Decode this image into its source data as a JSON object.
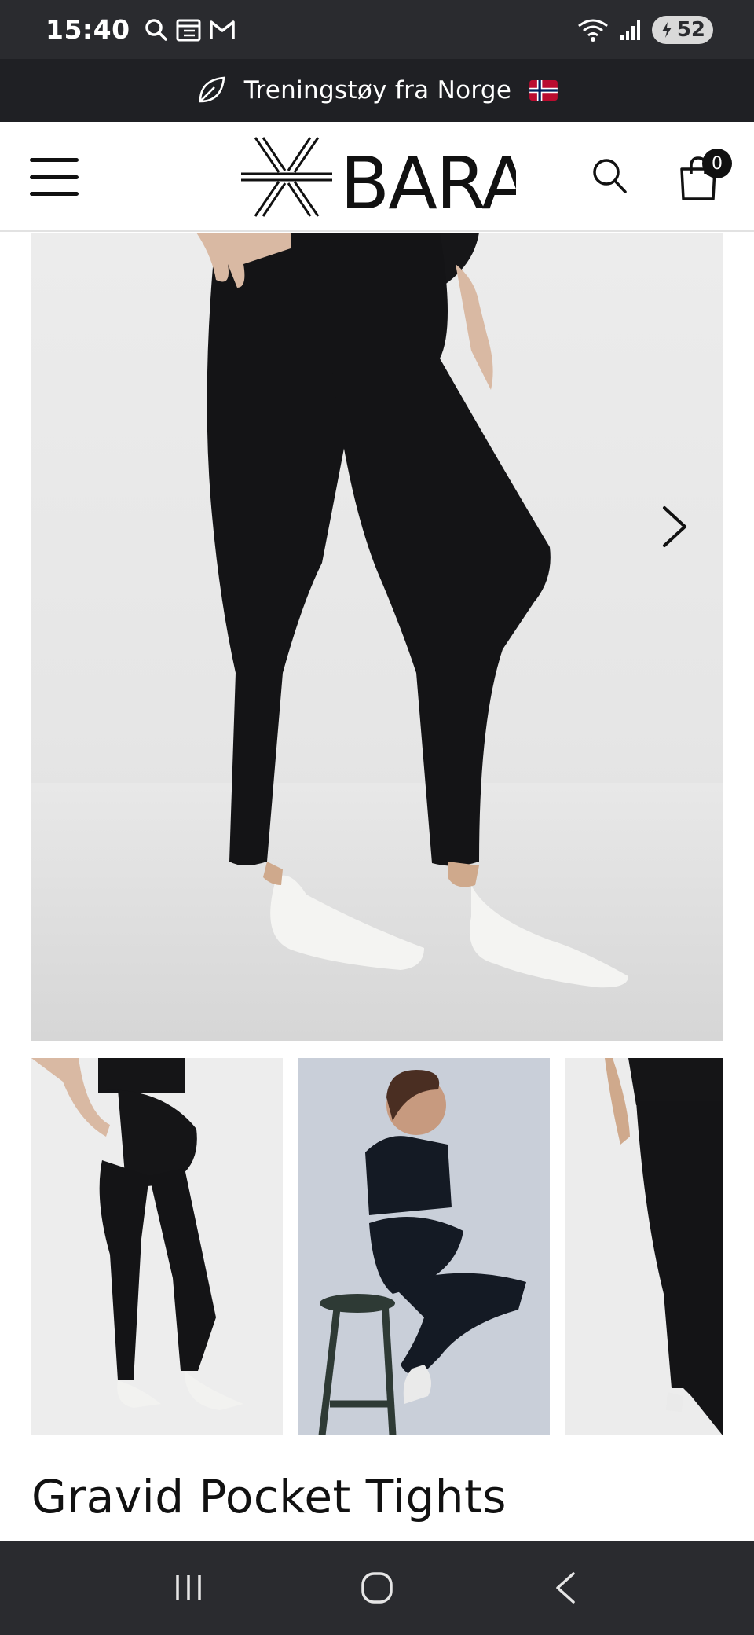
{
  "status_bar": {
    "time": "15:40",
    "battery": "52",
    "icons": [
      "search-icon",
      "calendar-icon",
      "gmail-icon",
      "wifi-icon",
      "signal-icon",
      "battery-icon"
    ]
  },
  "announcement": {
    "text": "Treningstøy fra Norge",
    "icon": "leaf-icon",
    "flag": "norway-flag"
  },
  "header": {
    "logo_text": "BARA",
    "cart_count": "0",
    "icons": [
      "menu-icon",
      "search-icon",
      "cart-icon"
    ]
  },
  "gallery": {
    "next_icon": "chevron-right-icon",
    "thumbnails": 3
  },
  "product": {
    "title": "Gravid Pocket Tights"
  },
  "nav_bar": {
    "icons": [
      "recents-icon",
      "home-icon",
      "back-icon"
    ]
  },
  "colors": {
    "status_bg": "#2a2b2f",
    "announce_bg": "#1f2024",
    "text": "#111111",
    "legging": "#141416"
  }
}
